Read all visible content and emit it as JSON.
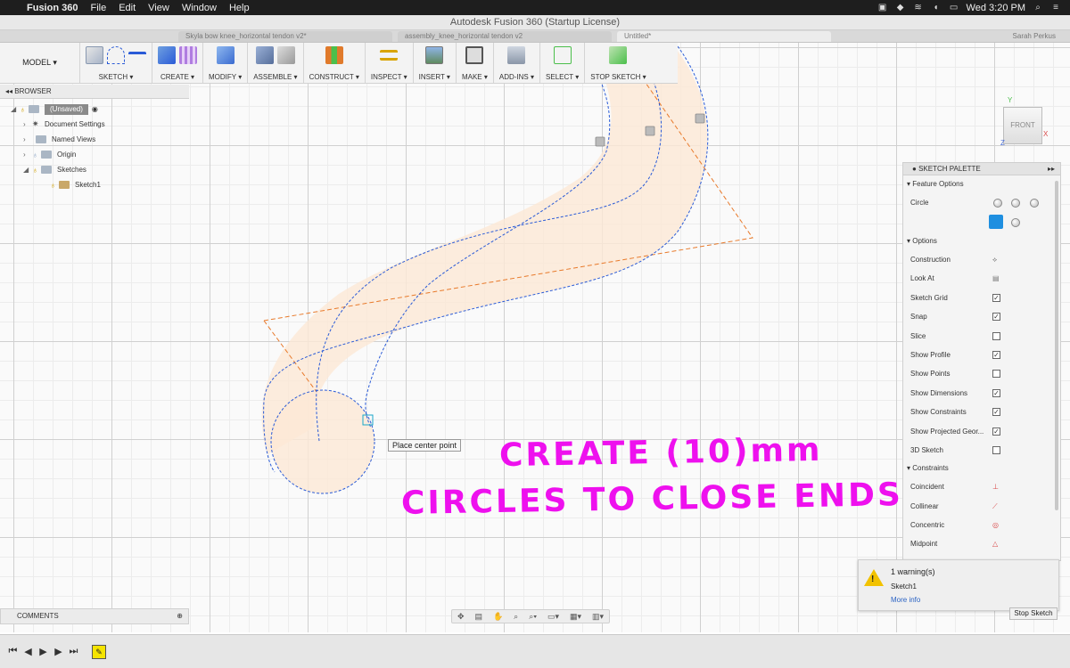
{
  "menubar": {
    "app": "Fusion 360",
    "menus": [
      "File",
      "Edit",
      "View",
      "Window",
      "Help"
    ],
    "clock": "Wed 3:20 PM"
  },
  "window_title": "Autodesk Fusion 360 (Startup License)",
  "doc_tabs": [
    "Skyla bow knee_horizontal tendon v2*",
    "assembly_knee_horizontal tendon v2",
    "Untitled*"
  ],
  "user_name": "Sarah Perkus",
  "toolbar": {
    "mode": "MODEL ▾",
    "groups": [
      "SKETCH ▾",
      "CREATE ▾",
      "MODIFY ▾",
      "ASSEMBLE ▾",
      "CONSTRUCT ▾",
      "INSPECT ▾",
      "INSERT ▾",
      "MAKE ▾",
      "ADD-INS ▾",
      "SELECT ▾",
      "STOP SKETCH ▾"
    ]
  },
  "browser": {
    "title": "BROWSER",
    "items": [
      "(Unsaved)",
      "Document Settings",
      "Named Views",
      "Origin",
      "Sketches",
      "Sketch1"
    ]
  },
  "comments_label": "COMMENTS",
  "viewcube": {
    "face": "FRONT",
    "axis_x": "X",
    "axis_y": "Y",
    "axis_z": "Z"
  },
  "palette": {
    "title": "SKETCH PALETTE",
    "feature_options": "Feature Options",
    "circle_label": "Circle",
    "options_header": "Options",
    "options": [
      {
        "label": "Construction",
        "state": "icon"
      },
      {
        "label": "Look At",
        "state": "icon"
      },
      {
        "label": "Sketch Grid",
        "state": "checked"
      },
      {
        "label": "Snap",
        "state": "checked"
      },
      {
        "label": "Slice",
        "state": "unchecked"
      },
      {
        "label": "Show Profile",
        "state": "checked"
      },
      {
        "label": "Show Points",
        "state": "unchecked"
      },
      {
        "label": "Show Dimensions",
        "state": "checked"
      },
      {
        "label": "Show Constraints",
        "state": "checked"
      },
      {
        "label": "Show Projected Geor...",
        "state": "checked"
      },
      {
        "label": "3D Sketch",
        "state": "unchecked"
      }
    ],
    "constraints_header": "Constraints",
    "constraints": [
      "Coincident",
      "Collinear",
      "Concentric",
      "Midpoint"
    ]
  },
  "warning": {
    "title": "1 warning(s)",
    "source": "Sketch1",
    "link": "More info"
  },
  "stop_sketch_label": "Stop Sketch",
  "tooltip": "Place center point",
  "annotation": {
    "line1": "CREATE (10)mm",
    "line2": "CIRCLES TO CLOSE ENDS"
  },
  "colors": {
    "annotation": "#ee10ee",
    "sketch_curve": "#2a5bd7",
    "construction": "#e87a2b",
    "profile_fill": "#fde9d6"
  }
}
